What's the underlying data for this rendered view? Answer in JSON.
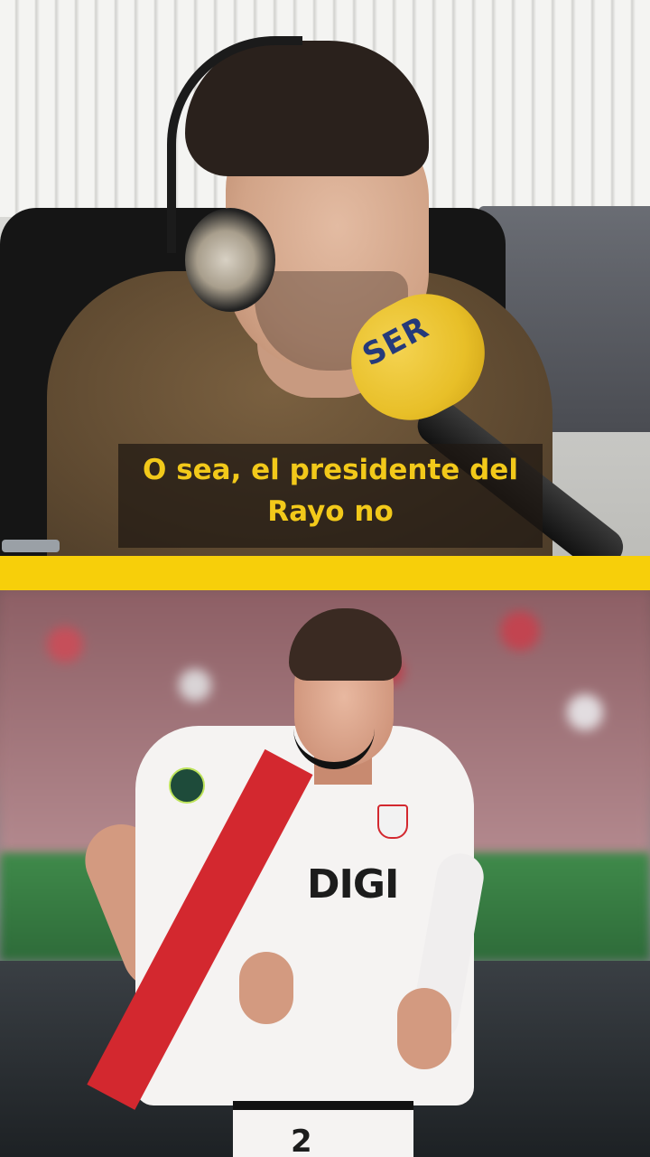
{
  "video": {
    "subtitle_line1": "O sea, el presidente del",
    "subtitle_line2": "Rayo no",
    "mic_brand": "SER",
    "accent_color": "#f7cf0a",
    "subtitle_color": "#f2c91a"
  },
  "player": {
    "sponsor": "DIGI",
    "number": "2"
  }
}
